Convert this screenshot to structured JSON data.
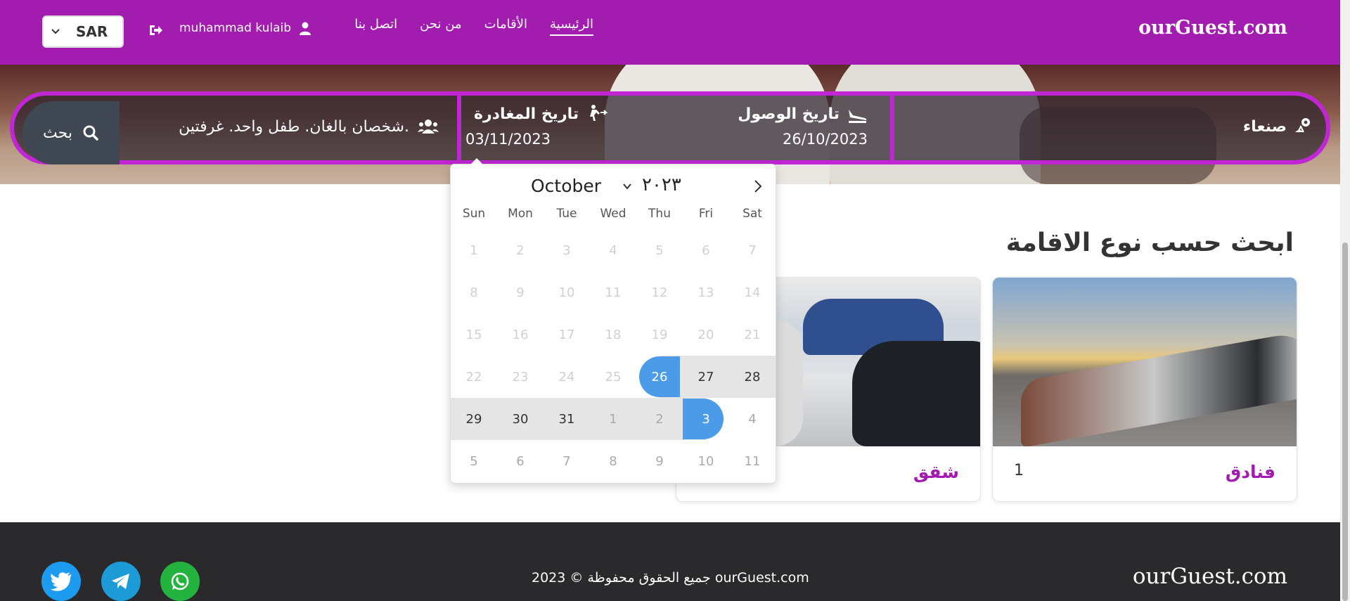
{
  "header": {
    "brand": "ourGuest.com",
    "nav": [
      {
        "label": "الرئيسية",
        "active": true
      },
      {
        "label": "الأقامات",
        "active": false
      },
      {
        "label": "من نحن",
        "active": false
      },
      {
        "label": "اتصل بنا",
        "active": false
      }
    ],
    "user_name": "muhammad kulaib",
    "currency": "SAR",
    "accent_color": "#a21caf"
  },
  "search": {
    "location_label": "صنعاء",
    "arrival_label": "تاريخ الوصول",
    "arrival_date": "26/10/2023",
    "departure_label": "تاريخ المغادرة",
    "departure_date": "03/11/2023",
    "guests_text": "شخصان بالغان. طفل واحد. غرفتين.",
    "search_button": "بحث"
  },
  "calendar": {
    "month": "October",
    "year": "٢٠٢٣",
    "weekdays": [
      "Sun",
      "Mon",
      "Tue",
      "Wed",
      "Thu",
      "Fri",
      "Sat"
    ],
    "rows": [
      [
        "1",
        "2",
        "3",
        "4",
        "5",
        "6",
        "7"
      ],
      [
        "8",
        "9",
        "10",
        "11",
        "12",
        "13",
        "14"
      ],
      [
        "15",
        "16",
        "17",
        "18",
        "19",
        "20",
        "21"
      ],
      [
        "22",
        "23",
        "24",
        "25",
        "26",
        "27",
        "28"
      ],
      [
        "29",
        "30",
        "31",
        "1",
        "2",
        "3",
        "4"
      ],
      [
        "5",
        "6",
        "7",
        "8",
        "9",
        "10",
        "11"
      ]
    ],
    "selected_start": "26",
    "selected_end": "3",
    "selection_color": "#4c9be8"
  },
  "section": {
    "title": "ابحث حسب نوع الاقامة",
    "cards": [
      {
        "title": "فنادق",
        "count": "1"
      },
      {
        "title": "شقق",
        "count": ""
      }
    ]
  },
  "footer": {
    "brand": "ourGuest.com",
    "copyright": "جميع الحقوق محفوظة © 2023 ourGuest.com",
    "social": [
      "whatsapp-icon",
      "telegram-icon",
      "twitter-icon"
    ]
  }
}
